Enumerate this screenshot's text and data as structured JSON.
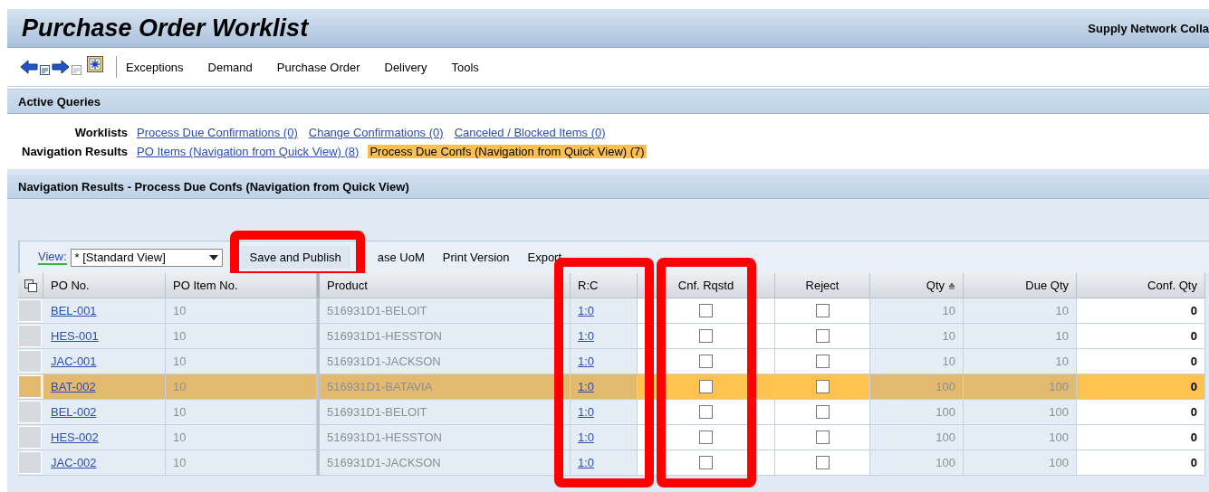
{
  "header": {
    "title": "Purchase Order Worklist",
    "app_name": "Supply Network Colla"
  },
  "menu": [
    "Exceptions",
    "Demand",
    "Purchase Order",
    "Delivery",
    "Tools"
  ],
  "active_queries": {
    "title": "Active Queries",
    "groups": [
      {
        "label": "Worklists",
        "links": [
          {
            "text": "Process Due Confirmations (0)",
            "selected": false
          },
          {
            "text": "Change Confirmations (0)",
            "selected": false
          },
          {
            "text": "Canceled / Blocked Items (0)",
            "selected": false
          }
        ]
      },
      {
        "label": "Navigation Results",
        "links": [
          {
            "text": "PO Items (Navigation from Quick View) (8)",
            "selected": false
          },
          {
            "text": "Process Due Confs (Navigation from Quick View) (7)",
            "selected": true
          }
        ]
      }
    ]
  },
  "results": {
    "title": "Navigation Results - Process Due Confs (Navigation from Quick View)",
    "view_label": "View:",
    "view_value": "* [Standard View]",
    "toolbar": [
      {
        "label": "Save and Publish",
        "kind": "button",
        "highlighted": true
      },
      {
        "label": "ase UoM",
        "kind": "button",
        "highlighted": false
      },
      {
        "label": "Print Version",
        "kind": "button",
        "highlighted": false
      },
      {
        "label": "Export",
        "kind": "menu",
        "highlighted": false
      }
    ],
    "columns": [
      {
        "label": "PO No.",
        "kind": "link",
        "highlighted": false
      },
      {
        "label": "PO Item No.",
        "kind": "text",
        "highlighted": false
      },
      {
        "label": "Product",
        "kind": "text",
        "highlighted": false
      },
      {
        "label": "R:C",
        "kind": "link",
        "highlighted": true
      },
      {
        "label": "Cnf. Rqstd",
        "kind": "checkbox",
        "highlighted": true
      },
      {
        "label": "Reject",
        "kind": "checkbox",
        "highlighted": false
      },
      {
        "label": "Qty",
        "kind": "number",
        "highlighted": false,
        "sorted": true
      },
      {
        "label": "Due Qty",
        "kind": "number",
        "highlighted": false,
        "sorted": false
      },
      {
        "label": "Conf. Qty",
        "kind": "input",
        "highlighted": false,
        "sorted": false
      }
    ],
    "rows": [
      {
        "selected": false,
        "cells": [
          "BEL-001",
          "10",
          "516931D1-BELOIT",
          "1:0",
          {
            "checked": false
          },
          {
            "checked": false
          },
          "10",
          "10",
          "0"
        ]
      },
      {
        "selected": false,
        "cells": [
          "HES-001",
          "10",
          "516931D1-HESSTON",
          "1:0",
          {
            "checked": false
          },
          {
            "checked": false
          },
          "10",
          "10",
          "0"
        ]
      },
      {
        "selected": false,
        "cells": [
          "JAC-001",
          "10",
          "516931D1-JACKSON",
          "1:0",
          {
            "checked": false
          },
          {
            "checked": false
          },
          "10",
          "10",
          "0"
        ]
      },
      {
        "selected": true,
        "cells": [
          "BAT-002",
          "10",
          "516931D1-BATAVIA",
          "1:0",
          {
            "checked": false
          },
          {
            "checked": false
          },
          "100",
          "100",
          "0"
        ]
      },
      {
        "selected": false,
        "cells": [
          "BEL-002",
          "10",
          "516931D1-BELOIT",
          "1:0",
          {
            "checked": false
          },
          {
            "checked": false
          },
          "100",
          "100",
          "0"
        ]
      },
      {
        "selected": false,
        "cells": [
          "HES-002",
          "10",
          "516931D1-HESSTON",
          "1:0",
          {
            "checked": false
          },
          {
            "checked": false
          },
          "100",
          "100",
          "0"
        ]
      },
      {
        "selected": false,
        "cells": [
          "JAC-002",
          "10",
          "516931D1-JACKSON",
          "1:0",
          {
            "checked": false
          },
          {
            "checked": false
          },
          "100",
          "100",
          "0"
        ]
      }
    ]
  }
}
